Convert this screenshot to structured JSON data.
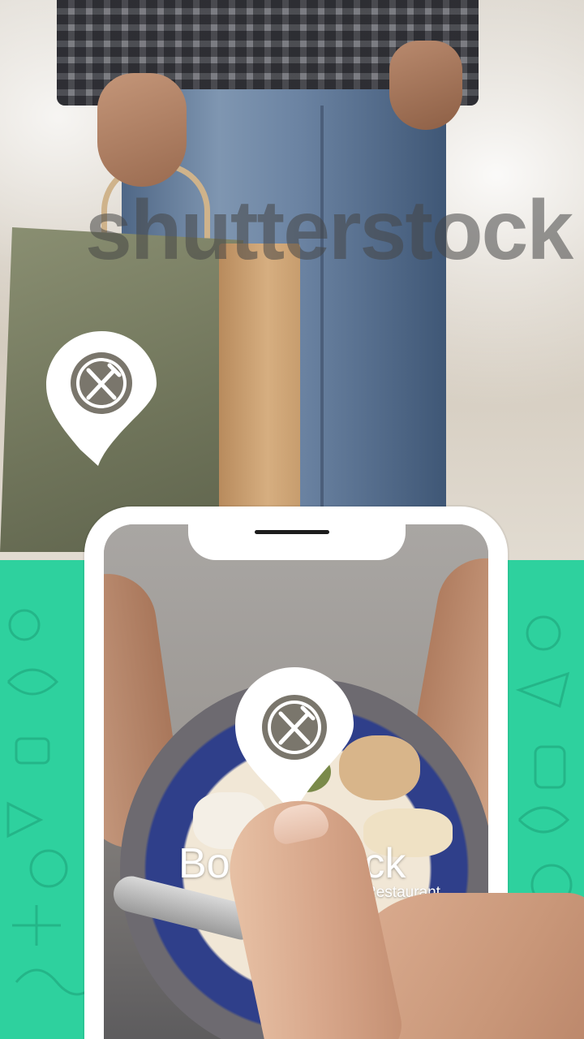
{
  "brand": {
    "title": "Book & Pick",
    "subtitle": "Restaurant",
    "watermark_text": "shutterstock"
  },
  "colors": {
    "accent_green": "#2ed19e",
    "phone_frame": "#ffffff",
    "pin_fill": "#ffffff",
    "pin_ring": "#7a766c"
  },
  "icons": {
    "pin_bag": "restaurant-location-pin-icon",
    "pin_phone": "restaurant-location-pin-icon",
    "cutlery": "knife-fork-icon"
  }
}
